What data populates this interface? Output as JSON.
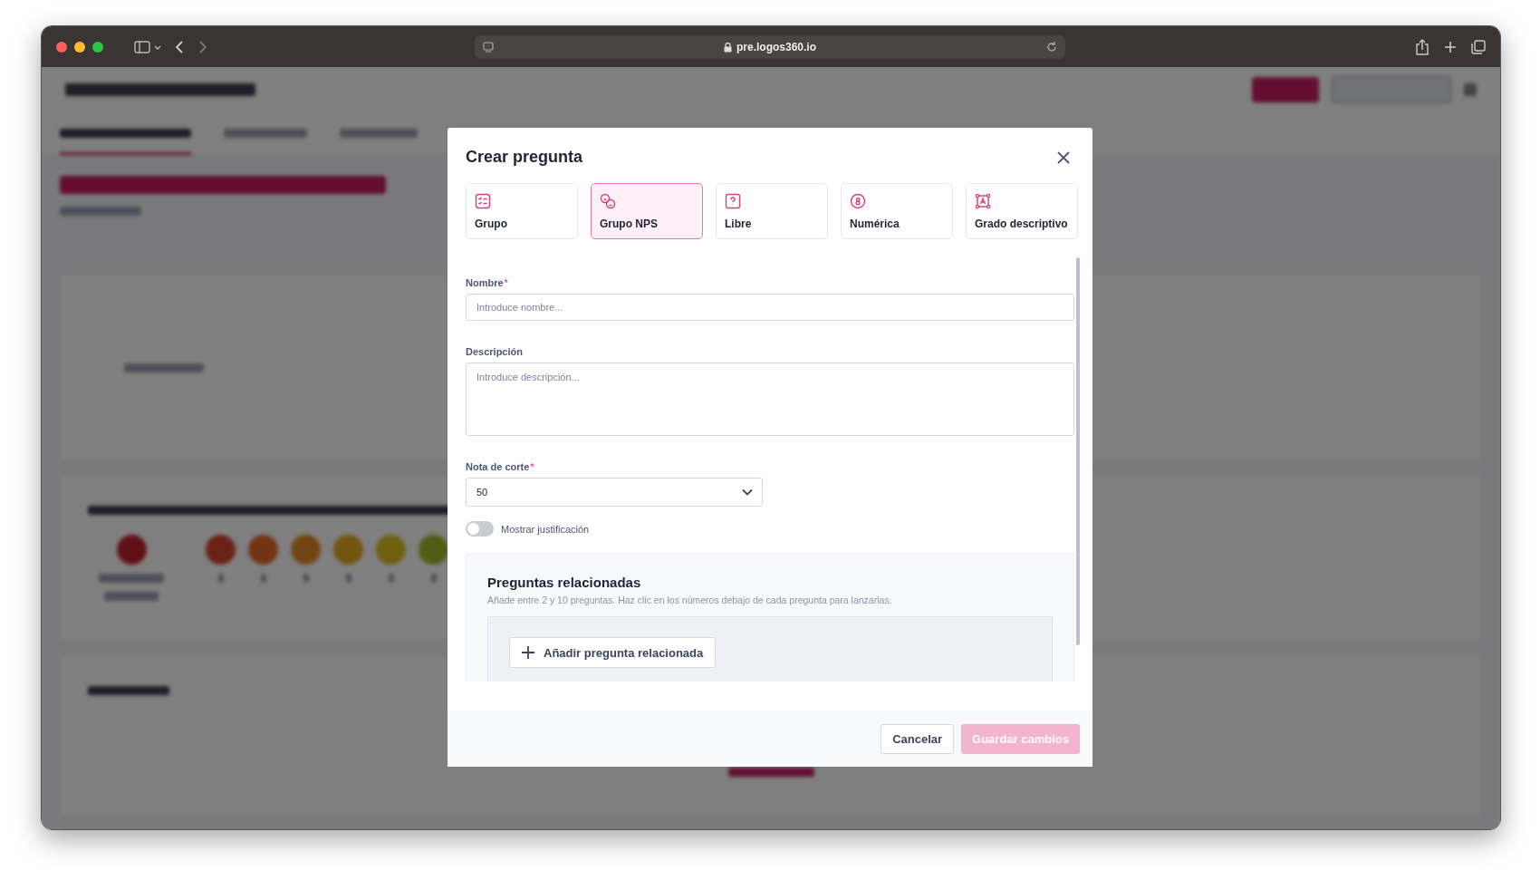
{
  "browser": {
    "url": "pre.logos360.io"
  },
  "modal": {
    "title": "Crear pregunta",
    "types": [
      {
        "label": "Grupo",
        "kind": "list",
        "selected": false
      },
      {
        "label": "Grupo NPS",
        "kind": "faces",
        "selected": true
      },
      {
        "label": "Libre",
        "kind": "question",
        "selected": false
      },
      {
        "label": "Numérica",
        "kind": "number",
        "selected": false
      },
      {
        "label": "Grado descriptivo",
        "kind": "frame",
        "selected": false
      }
    ],
    "name": {
      "label": "Nombre",
      "required_mark": "*",
      "placeholder": "Introduce nombre..."
    },
    "description": {
      "label": "Descripción",
      "placeholder": "Introduce descripción..."
    },
    "cutoff": {
      "label": "Nota de corte",
      "required_mark": "*",
      "value": "50"
    },
    "justification": {
      "label": "Mostrar justificación",
      "on": false
    },
    "related": {
      "title": "Preguntas relacionadas",
      "hint": "Añade entre 2 y 10 preguntas. Haz clic en los números debajo de cada pregunta para lanzarlas.",
      "add_button": "Añadir pregunta relacionada"
    },
    "cancel_button": "Cancelar",
    "save_button": {
      "label": "Guardar cambios",
      "disabled": true
    }
  }
}
